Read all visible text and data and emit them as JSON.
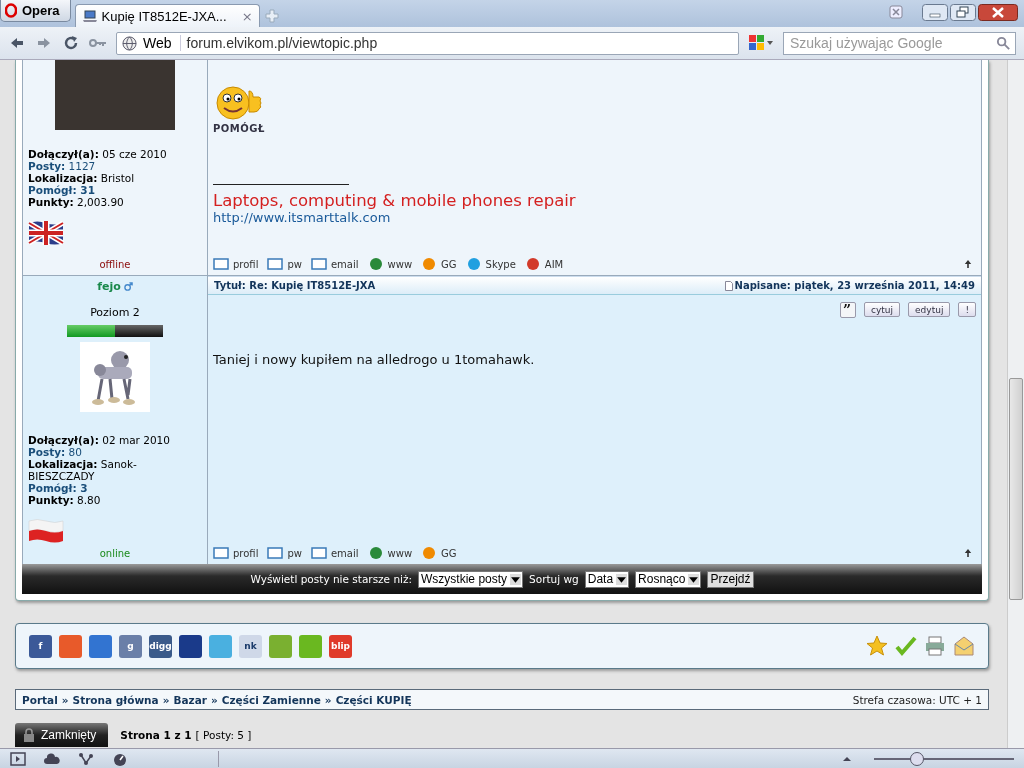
{
  "browser": {
    "menu_button": "Opera",
    "tabs": [
      {
        "title": "Kupię IT8512E-JXA...",
        "close": "×",
        "selected": true
      }
    ],
    "address_label": "Web",
    "address": "forum.elvikom.pl/viewtopic.php",
    "search": {
      "placeholder": "Szukaj używając Google"
    }
  },
  "posts": [
    {
      "avatar": {
        "kind": "photo"
      },
      "details": [
        {
          "label": "Dołączył(a):",
          "value": "05 cze 2010",
          "kind": "plain"
        },
        {
          "label": "Posty:",
          "value": "1127",
          "kind": "link"
        },
        {
          "label": "Lokalizacja:",
          "value": "Bristol",
          "kind": "plain"
        },
        {
          "label": "Pomógł:",
          "value": "31",
          "kind": "strong"
        },
        {
          "label": "Punkty:",
          "value": "2,003.90",
          "kind": "plain"
        }
      ],
      "flag": {
        "kind": "uk"
      },
      "status": "offline",
      "online": false,
      "helped_badge": "POMÓGŁ",
      "signature": "Laptops, computing & mobile phones repair",
      "signature_link": "http://www.itsmarttalk.com",
      "actions": [
        {
          "kind": "profile",
          "label": "profil"
        },
        {
          "kind": "pm",
          "label": "pw"
        },
        {
          "kind": "email",
          "label": "email"
        },
        {
          "kind": "www",
          "label": "www"
        },
        {
          "kind": "gg",
          "label": "GG"
        },
        {
          "kind": "skype",
          "label": "Skype"
        },
        {
          "kind": "aim",
          "label": "AIM"
        }
      ]
    },
    {
      "author": "fejo",
      "rank": "Poziom 2",
      "level": 0.5,
      "avatar": {
        "kind": "robot"
      },
      "title": "Tytuł: Re: Kupię IT8512E-JXA",
      "date": "Napisane: piątek, 23 września 2011, 14:49",
      "quote_icon": "”",
      "buttons": [
        "cytuj",
        "edytuj",
        "!"
      ],
      "details": [
        {
          "label": "Dołączył(a):",
          "value": "02 mar 2010",
          "kind": "plain"
        },
        {
          "label": "Posty:",
          "value": "80",
          "kind": "link"
        },
        {
          "label": "Lokalizacja:",
          "value": "Sanok-BIESZCZADY",
          "kind": "plain"
        },
        {
          "label": "Pomógł:",
          "value": "3",
          "kind": "strong"
        },
        {
          "label": "Punkty:",
          "value": "8.80",
          "kind": "plain"
        }
      ],
      "flag": {
        "kind": "pl"
      },
      "status": "online",
      "online": true,
      "body": "Taniej i nowy kupiłem na alledrogo u 1tomahawk.",
      "actions": [
        {
          "kind": "profile",
          "label": "profil"
        },
        {
          "kind": "pm",
          "label": "pw"
        },
        {
          "kind": "email",
          "label": "email"
        },
        {
          "kind": "www",
          "label": "www"
        },
        {
          "kind": "gg",
          "label": "GG"
        }
      ]
    }
  ],
  "filter_bar": {
    "label": "Wyświetl posty nie starsze niż:",
    "period": "Wszystkie posty",
    "sort_label": "Sortuj wg",
    "sort_by": "Data",
    "order": "Rosnąco",
    "submit": "Przejdź"
  },
  "share": [
    {
      "kind": "facebook",
      "label": "f"
    },
    {
      "kind": "wykop"
    },
    {
      "kind": "delicious"
    },
    {
      "kind": "google",
      "label": "g"
    },
    {
      "kind": "digg",
      "label": "digg"
    },
    {
      "kind": "myspace"
    },
    {
      "kind": "twitter"
    },
    {
      "kind": "nk",
      "label": "nk"
    },
    {
      "kind": "flaker"
    },
    {
      "kind": "check"
    },
    {
      "kind": "blip",
      "label": "blip"
    }
  ],
  "share_right": [
    {
      "kind": "star"
    },
    {
      "kind": "check"
    },
    {
      "kind": "print"
    },
    {
      "kind": "mail"
    }
  ],
  "breadcrumb": [
    "Portal",
    "Strona główna",
    "Bazar",
    "Części Zamienne",
    "Części KUPIĘ"
  ],
  "breadcrumb_separator": "»",
  "timezone": "Strefa czasowa: UTC + 1",
  "locked_button": "Zamknięty",
  "pagination": "Strona 1 z 1",
  "post_count": "[ Posty: 5 ]",
  "status_bar": {
    "zoom": {
      "level": 0.3
    }
  }
}
